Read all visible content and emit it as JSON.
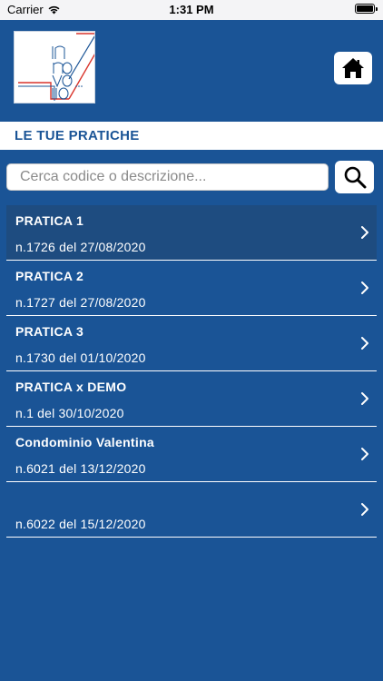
{
  "status_bar": {
    "carrier": "Carrier",
    "time": "1:31 PM"
  },
  "section": {
    "title": "LE TUE PRATICHE"
  },
  "search": {
    "placeholder": "Cerca codice o descrizione..."
  },
  "pratiche": [
    {
      "title": "PRATICA 1",
      "subtitle": "n.1726 del 27/08/2020"
    },
    {
      "title": "PRATICA 2",
      "subtitle": "n.1727 del 27/08/2020"
    },
    {
      "title": "PRATICA 3",
      "subtitle": "n.1730 del 01/10/2020"
    },
    {
      "title": "PRATICA x DEMO",
      "subtitle": "n.1 del 30/10/2020"
    },
    {
      "title": "Condominio Valentina",
      "subtitle": "n.6021 del 13/12/2020"
    },
    {
      "title": "",
      "subtitle": "n.6022 del 15/12/2020"
    }
  ],
  "colors": {
    "primary": "#1a5496",
    "selected_row": "#1e4c80",
    "accent_red": "#d9342b"
  },
  "icons": {
    "home": "home-icon",
    "search": "search-icon",
    "chevron": "chevron-right-icon",
    "wifi": "wifi-icon",
    "battery": "battery-icon"
  }
}
